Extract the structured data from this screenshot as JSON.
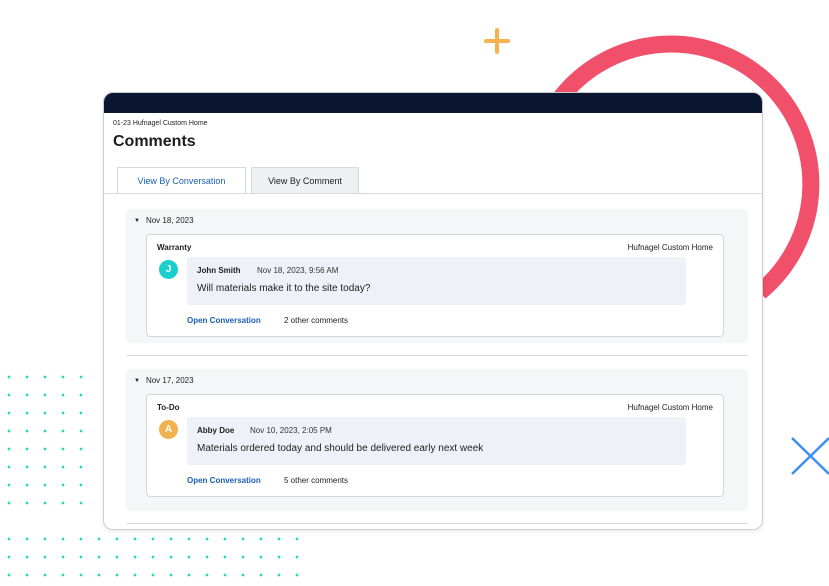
{
  "project_name": "01-23 Hufnagel Custom Home",
  "page_title": "Comments",
  "tabs": [
    {
      "label": "View By Conversation",
      "active": true
    },
    {
      "label": "View By Comment",
      "active": false
    }
  ],
  "groups": [
    {
      "date": "Nov 18, 2023",
      "card": {
        "type": "Warranty",
        "project": "Hufnagel Custom Home",
        "avatar_initial": "J",
        "author": "John Smith",
        "timestamp": "Nov 18, 2023, 9:56 AM",
        "message": "Will materials make it to the site today?",
        "link_label": "Open Conversation",
        "other_comments": "2 other comments"
      }
    },
    {
      "date": "Nov 17, 2023",
      "card": {
        "type": "To-Do",
        "project": "Hufnagel Custom Home",
        "avatar_initial": "A",
        "author": "Abby Doe",
        "timestamp": "Nov 10, 2023, 2:05 PM",
        "message": "Materials ordered today and should be delivered early next week",
        "link_label": "Open Conversation",
        "other_comments": "5 other comments"
      }
    }
  ],
  "colors": {
    "titlebar": "#0b1631",
    "accent_link": "#1a5fb4",
    "ring": "#f0506a",
    "plus": "#f6b24f",
    "cross": "#3d8ff0",
    "dots": "#2ed3c8",
    "avatar_j": "#1ccfcf",
    "avatar_a": "#f2b14f"
  }
}
